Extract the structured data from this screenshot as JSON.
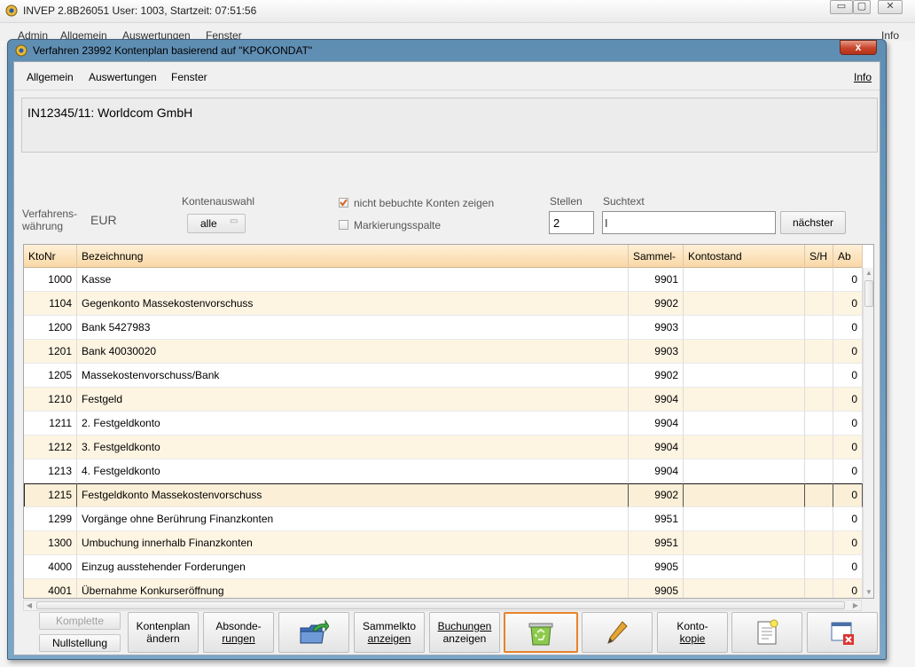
{
  "outer": {
    "title": "INVEP 2.8B26051 User: 1003, Startzeit: 07:51:56",
    "menu": [
      "Admin",
      "Allgemein",
      "Auswertungen",
      "Fenster",
      "Info"
    ],
    "controls": {
      "minimize": "▭",
      "maximize": "▢",
      "close": "✕"
    }
  },
  "dialog": {
    "title": "Verfahren 23992 Kontenplan basierend auf \"KPOKONDAT\"",
    "close": "x",
    "menu": {
      "allgemein": "Allgemein",
      "auswertungen": "Auswertungen",
      "fenster": "Fenster",
      "info": "Info"
    },
    "case_title": "IN12345/11: Worldcom GmbH"
  },
  "filters": {
    "currency_label_1": "Verfahrens-",
    "currency_label_2": "währung",
    "currency_value": "EUR",
    "kontenauswahl_label": "Kontenauswahl",
    "kontenauswahl_value": "alle",
    "checkbox_unbooked_label": "nicht bebuchte Konten zeigen",
    "checkbox_unbooked_checked": true,
    "checkbox_marking_label": "Markierungsspalte",
    "checkbox_marking_checked": false,
    "stellen_label": "Stellen",
    "stellen_value": "2",
    "suchtext_label": "Suchtext",
    "suchtext_value": "",
    "next_button": "nächster"
  },
  "table": {
    "columns": [
      "KtoNr",
      "Bezeichnung",
      "Sammel-",
      "Kontostand",
      "S/H",
      "Ab"
    ],
    "rows": [
      {
        "kto": "1000",
        "bez": "Kasse",
        "sammel": "9901",
        "stand": "",
        "sh": "",
        "ab": "0"
      },
      {
        "kto": "1104",
        "bez": "Gegenkonto Massekostenvorschuss",
        "sammel": "9902",
        "stand": "",
        "sh": "",
        "ab": "0"
      },
      {
        "kto": "1200",
        "bez": "Bank 5427983",
        "sammel": "9903",
        "stand": "",
        "sh": "",
        "ab": "0"
      },
      {
        "kto": "1201",
        "bez": "Bank 40030020",
        "sammel": "9903",
        "stand": "",
        "sh": "",
        "ab": "0"
      },
      {
        "kto": "1205",
        "bez": "Massekostenvorschuss/Bank",
        "sammel": "9902",
        "stand": "",
        "sh": "",
        "ab": "0"
      },
      {
        "kto": "1210",
        "bez": "Festgeld",
        "sammel": "9904",
        "stand": "",
        "sh": "",
        "ab": "0"
      },
      {
        "kto": "1211",
        "bez": "2. Festgeldkonto",
        "sammel": "9904",
        "stand": "",
        "sh": "",
        "ab": "0"
      },
      {
        "kto": "1212",
        "bez": "3. Festgeldkonto",
        "sammel": "9904",
        "stand": "",
        "sh": "",
        "ab": "0"
      },
      {
        "kto": "1213",
        "bez": "4. Festgeldkonto",
        "sammel": "9904",
        "stand": "",
        "sh": "",
        "ab": "0"
      },
      {
        "kto": "1215",
        "bez": "Festgeldkonto Massekostenvorschuss",
        "sammel": "9902",
        "stand": "",
        "sh": "",
        "ab": "0"
      },
      {
        "kto": "1299",
        "bez": "Vorgänge ohne Berührung Finanzkonten",
        "sammel": "9951",
        "stand": "",
        "sh": "",
        "ab": "0"
      },
      {
        "kto": "1300",
        "bez": "Umbuchung innerhalb Finanzkonten",
        "sammel": "9951",
        "stand": "",
        "sh": "",
        "ab": "0"
      },
      {
        "kto": "4000",
        "bez": "Einzug ausstehender Forderungen",
        "sammel": "9905",
        "stand": "",
        "sh": "",
        "ab": "0"
      },
      {
        "kto": "4001",
        "bez": "Übernahme Konkurseröffnung",
        "sammel": "9905",
        "stand": "",
        "sh": "",
        "ab": "0"
      }
    ],
    "selected_row": 9
  },
  "toolbar": {
    "komplette": "Komplette",
    "nullstellung": "Nullstellung",
    "kontenplan_1": "Kontenplan",
    "kontenplan_2": "ändern",
    "absonde_1": "Absonde-",
    "absonde_2": "rungen",
    "export_icon": "folder-export-icon",
    "sammelkto_1": "Sammelkto",
    "sammelkto_2": "anzeigen",
    "buchungen_1": "Buchungen",
    "buchungen_2": "anzeigen",
    "recycle_icon": "recycle-bin-icon",
    "edit_icon": "pencil-icon",
    "kopie_1": "Konto-",
    "kopie_2": "kopie",
    "notes_icon": "notepad-icon",
    "close_icon": "close-window-icon"
  },
  "colors": {
    "header_orange": "#f9d8a6",
    "row_alt": "#fdf4e2",
    "active_border": "#e8822a",
    "dialog_frame": "#6b97bb"
  }
}
